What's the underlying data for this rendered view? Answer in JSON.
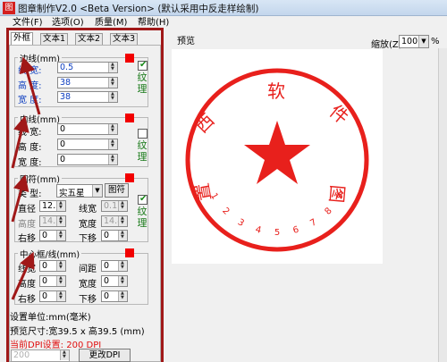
{
  "window": {
    "icon_text": "图",
    "title": "图章制作V2.0 <Beta Version> (默认采用中反走样绘制)"
  },
  "menu": [
    {
      "label": "文件(F)"
    },
    {
      "label": "选项(O)"
    },
    {
      "label": "质量(M)"
    },
    {
      "label": "帮助(H)"
    }
  ],
  "tabs": [
    {
      "label": "外框"
    },
    {
      "label": "文本1"
    },
    {
      "label": "文本2"
    },
    {
      "label": "文本3"
    }
  ],
  "groups": {
    "border": {
      "title": "边线(mm)",
      "rows": [
        {
          "label": "线 宽:",
          "value": "0.5"
        },
        {
          "label": "高  度:",
          "value": "38"
        },
        {
          "label": "宽  度:",
          "value": "38"
        }
      ],
      "texture_label": "纹理",
      "texture_checked": true
    },
    "inner": {
      "title": "内线(mm)",
      "rows": [
        {
          "label": "线 宽:",
          "value": "0"
        },
        {
          "label": "高  度:",
          "value": "0"
        },
        {
          "label": "宽  度:",
          "value": "0"
        }
      ],
      "texture_label": "纹理",
      "texture_checked": false
    },
    "shape": {
      "title": "图符(mm)",
      "type_label": "类  型:",
      "type_value": "实五星",
      "shape_button": "图符",
      "diameter_label": "直径",
      "diameter_value": "12.5",
      "linewidth_label": "线宽",
      "linewidth_value": "0.1",
      "height_label": "高度",
      "height_value": "14.3",
      "width_label": "宽度",
      "width_value": "14.8",
      "right_label": "右移",
      "right_value": "0",
      "down_label": "下移",
      "down_value": "0",
      "texture_label": "纹理",
      "texture_checked": true
    },
    "center": {
      "title": "中心框/线(mm)",
      "linewidth_label": "线宽",
      "linewidth_value": "0",
      "spacing_label": "间距",
      "spacing_value": "0",
      "height_label": "高度",
      "height_value": "0",
      "width_label": "宽度",
      "width_value": "0",
      "right_label": "右移",
      "right_value": "0",
      "down_label": "下移",
      "down_value": "0"
    }
  },
  "info": {
    "unit": "设置单位:mm(毫米)",
    "preview_size": "预览尺寸:宽39.5 x 高39.5 (mm)",
    "dpi_setting": "当前DPI设置: 200 DPI",
    "dpi_value": "200",
    "change_dpi_button": "更改DPI"
  },
  "preview": {
    "label": "预览",
    "zoom_label": "缩放(Z)",
    "zoom_value": "100",
    "zoom_unit": "%",
    "stamp_color": "#e8201c",
    "stamp_top_text": [
      "西",
      "软",
      "件"
    ],
    "stamp_side_text_left": "置",
    "stamp_side_text_right": "图",
    "stamp_numbers": [
      "1",
      "2",
      "3",
      "4",
      "5",
      "6",
      "7",
      "8",
      "9"
    ]
  },
  "colors": {
    "border_color": "#f20000",
    "annotation_color": "#a01818"
  }
}
